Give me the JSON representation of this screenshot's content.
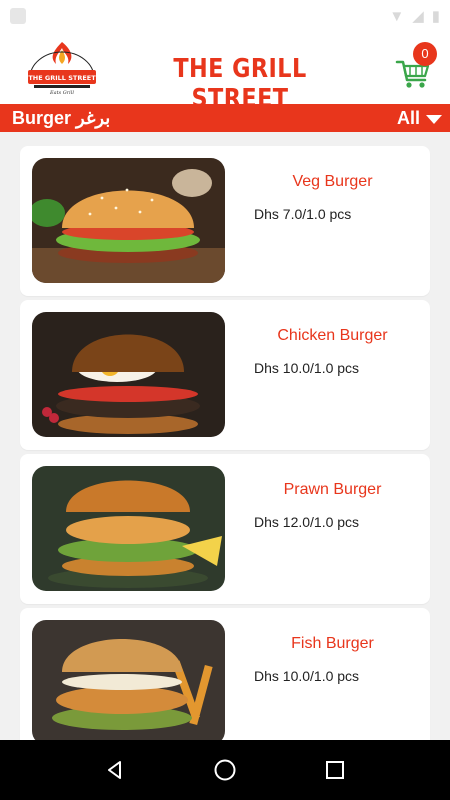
{
  "app": {
    "title": "THE GRILL STREET",
    "logo_top_text": "JOY OF GOOD FOOD",
    "logo_name": "THE GRILL STREET",
    "logo_tagline": "Eats Grill",
    "brand_color": "#e8361c"
  },
  "cart": {
    "count": "0",
    "icon": "cart-icon"
  },
  "category": {
    "label": "Burger  برغر",
    "filter": "All"
  },
  "products": [
    {
      "name": "Veg Burger",
      "price": "Dhs 7.0/1.0 pcs",
      "image": "veg-burger-photo"
    },
    {
      "name": "Chicken Burger",
      "price": "Dhs 10.0/1.0 pcs",
      "image": "chicken-burger-photo"
    },
    {
      "name": "Prawn Burger",
      "price": "Dhs 12.0/1.0 pcs",
      "image": "prawn-burger-photo"
    },
    {
      "name": "Fish Burger",
      "price": "Dhs 10.0/1.0 pcs",
      "image": "fish-burger-photo"
    }
  ],
  "navigation": {
    "back": "back-icon",
    "home": "home-icon",
    "recents": "recents-icon"
  }
}
